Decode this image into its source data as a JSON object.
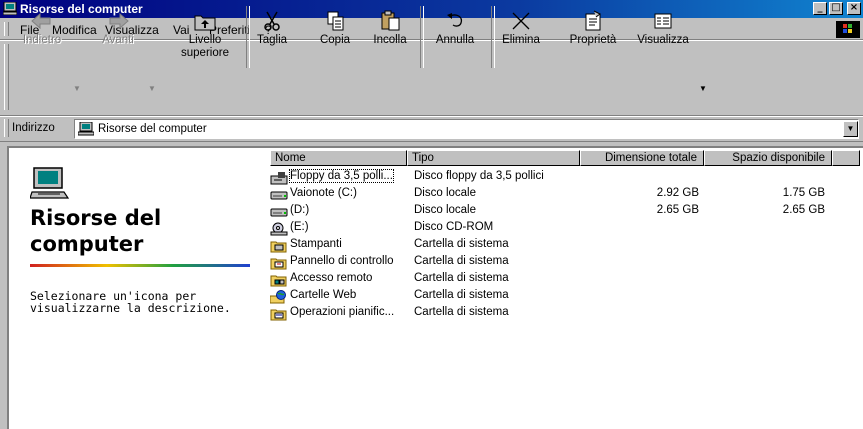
{
  "window": {
    "title": "Risorse del computer"
  },
  "menu": [
    "File",
    "Modifica",
    "Visualizza",
    "Vai",
    "Preferiti",
    "?"
  ],
  "toolbar": {
    "back": "Indietro",
    "forward": "Avanti",
    "up_line1": "Livello",
    "up_line2": "superiore",
    "cut": "Taglia",
    "copy": "Copia",
    "paste": "Incolla",
    "undo": "Annulla",
    "delete": "Elimina",
    "properties": "Proprietà",
    "views": "Visualizza"
  },
  "address": {
    "label": "Indirizzo",
    "value": "Risorse del computer"
  },
  "left_panel": {
    "title_line1": "Risorse del",
    "title_line2": "computer",
    "desc_line1": "Selezionare un'icona per",
    "desc_line2": "visualizzarne la descrizione."
  },
  "columns": [
    "Nome",
    "Tipo",
    "Dimensione totale",
    "Spazio disponibile"
  ],
  "rows": [
    {
      "name": "Floppy da 3,5 polli...",
      "type": "Disco floppy da 3,5 pollici",
      "total": "",
      "free": "",
      "icon": "floppy-drive-icon"
    },
    {
      "name": "Vaionote (C:)",
      "type": "Disco locale",
      "total": "2.92 GB",
      "free": "1.75 GB",
      "icon": "hard-drive-icon"
    },
    {
      "name": "(D:)",
      "type": "Disco locale",
      "total": "2.65 GB",
      "free": "2.65 GB",
      "icon": "hard-drive-icon"
    },
    {
      "name": "(E:)",
      "type": "Disco CD-ROM",
      "total": "",
      "free": "",
      "icon": "cdrom-drive-icon"
    },
    {
      "name": "Stampanti",
      "type": "Cartella di sistema",
      "total": "",
      "free": "",
      "icon": "printers-folder-icon"
    },
    {
      "name": "Pannello di controllo",
      "type": "Cartella di sistema",
      "total": "",
      "free": "",
      "icon": "control-panel-icon"
    },
    {
      "name": "Accesso remoto",
      "type": "Cartella di sistema",
      "total": "",
      "free": "",
      "icon": "dialup-networking-icon"
    },
    {
      "name": "Cartelle Web",
      "type": "Cartella di sistema",
      "total": "",
      "free": "",
      "icon": "web-folders-icon"
    },
    {
      "name": "Operazioni pianific...",
      "type": "Cartella di sistema",
      "total": "",
      "free": "",
      "icon": "scheduled-tasks-icon"
    }
  ]
}
